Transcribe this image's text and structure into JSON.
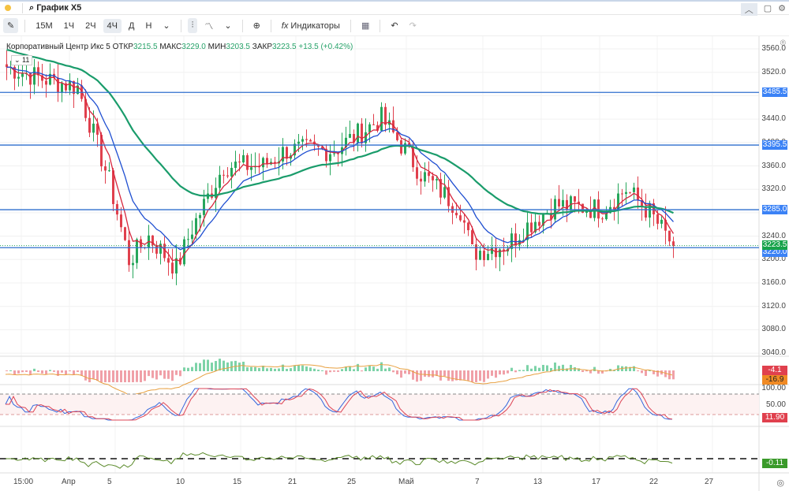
{
  "window": {
    "title": "График X5",
    "search_icon": "search-icon"
  },
  "toolbar": {
    "timeframes": [
      "15M",
      "1Ч",
      "2Ч",
      "4Ч",
      "Д",
      "Н"
    ],
    "active": "4Ч",
    "indicators": "Индикаторы",
    "more": "⌄"
  },
  "legend": {
    "name": "Корпоративный Центр Икс 5",
    "open_label": "ОТКР",
    "open": "3215.5",
    "high_label": "МАКС",
    "high": "3229.0",
    "low_label": "МИН",
    "low": "3203.5",
    "close_label": "ЗАКР",
    "close": "3223.5",
    "change": "+13.5 (+0.42%)",
    "collapsed_count": "11"
  },
  "chart_data": {
    "type": "candlestick",
    "price_axis": [
      "3560.0",
      "3520.0",
      "3480.0",
      "3440.0",
      "3400.0",
      "3360.0",
      "3320.0",
      "3280.0",
      "3240.0",
      "3200.0",
      "3160.0",
      "3120.0",
      "3080.0",
      "3040.0"
    ],
    "ylim": [
      3040,
      3560
    ],
    "time_axis": [
      "15:00",
      "Апр",
      "5",
      "10",
      "15",
      "21",
      "25",
      "Май",
      "7",
      "13",
      "17",
      "22",
      "27"
    ],
    "horizontal_levels": [
      {
        "value": 3485.5,
        "label": "3485.5"
      },
      {
        "value": 3395.5,
        "label": "3395.5"
      },
      {
        "value": 3285.0,
        "label": "3285.0"
      },
      {
        "value": 3220.0,
        "label": "3220.0"
      }
    ],
    "last_price": {
      "value": 3223.5,
      "label": "3223.5"
    },
    "close_anchors": [
      [
        0,
        3529
      ],
      [
        9,
        3509
      ],
      [
        18,
        3495
      ],
      [
        26,
        3334
      ],
      [
        31,
        3199
      ],
      [
        36,
        3239
      ],
      [
        43,
        3185
      ],
      [
        47,
        3253
      ],
      [
        55,
        3360
      ],
      [
        65,
        3360
      ],
      [
        71,
        3387
      ],
      [
        83,
        3387
      ],
      [
        95,
        3441
      ],
      [
        101,
        3387
      ],
      [
        105,
        3347
      ],
      [
        115,
        3286
      ],
      [
        118,
        3212
      ],
      [
        127,
        3226
      ],
      [
        131,
        3253
      ],
      [
        139,
        3293
      ],
      [
        151,
        3286
      ],
      [
        157,
        3320
      ],
      [
        163,
        3280
      ],
      [
        169,
        3223
      ]
    ],
    "ma_colors": {
      "fast": "#d7263d",
      "mid": "#1f4fd1",
      "slow": "#1a9c6b"
    },
    "macd": {
      "values": [
        "-4.1",
        "-16.9"
      ]
    },
    "oscillator": {
      "levels": [
        "100.00",
        "50.00"
      ],
      "value": "11.90"
    },
    "third": {
      "value": "-0.11"
    }
  },
  "colors": {
    "up": "#26a65b",
    "down": "#e0404d",
    "level": "#2f6fce",
    "tag": "#3b82f6",
    "last": "#16a34a"
  }
}
